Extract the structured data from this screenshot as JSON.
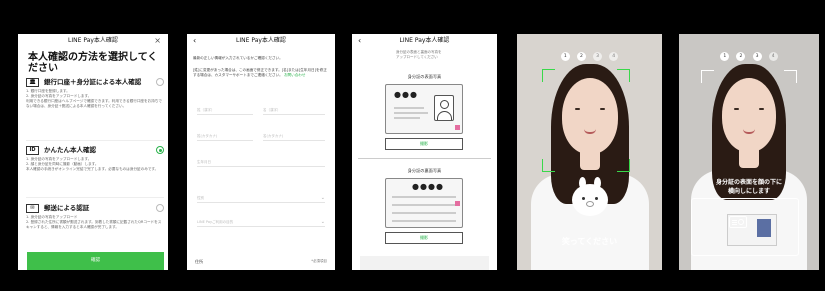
{
  "screen1": {
    "header_title": "LINE Pay本人確認",
    "close": "×",
    "title": "本人確認の方法を選択してください",
    "options": [
      {
        "label": "銀行口座＋身分証による本人確認",
        "icon": "bank-icon",
        "selected": false,
        "desc": "1. 銀行口座を登録します。\n2. 身分証の写真をアップロードします。\n利用できる銀行口座はヘルプページで確認できます。利用できる銀行口座をお持ちでない場合は、身分証＋郵送による本人確認を行ってください。"
      },
      {
        "label": "かんたん本人確認",
        "icon": "id-card-icon",
        "selected": true,
        "desc": "1. 身分証の写真をアップロードします。\n2. 顔と身分証を同時に撮影（動画）します。\n本人確認の手続きがオンライン完結で完了します。必要なものは身分証のみです。"
      },
      {
        "label": "郵送による認証",
        "icon": "mail-icon",
        "selected": false,
        "desc": "1. 身分証の写真をアップロード\n2. 登録された住所に書類が郵送されます。到着した書類に記載されたQRコードをスキャンすると、情報を入力すると本人確認が完了します。"
      }
    ],
    "confirm_label": "確認"
  },
  "screen2": {
    "header_title": "LINE Pay本人確認",
    "back": "‹",
    "intro": "最新の正しい情報が入力されているかご確認ください。",
    "notice": "[姓]に変更があった場合は、この画面で修正できます。[名]または[生年月日]を修正する場合は、カスタマーサポートまでご連絡ください。",
    "notice_link": "お問い合わせ",
    "fields": {
      "last_name": "姓（漢字）",
      "first_name": "名（漢字）",
      "last_kana": "姓(カタカナ)",
      "first_kana": "名(カタカナ)",
      "birthdate": "生年月日",
      "gender": "性別",
      "purpose": "LINE Payご利用の目的"
    },
    "address_label": "住所",
    "required_label": "*必須項目"
  },
  "screen3": {
    "header_title": "LINE Pay本人確認",
    "back": "‹",
    "note": "身分証の表面と裏面の写真を\nアップロードしてください",
    "front_caption": "身分証の表面写真",
    "back_caption": "身分証の裏面写真",
    "front_dots": "●●●",
    "back_dots": "●●●●",
    "snap_label": "撮影"
  },
  "screen4": {
    "steps": [
      "1",
      "2",
      "3",
      "4"
    ],
    "active_step": 2,
    "prompt": "笑ってください"
  },
  "screen5": {
    "steps": [
      "1",
      "2",
      "3",
      "4"
    ],
    "active_step": 3,
    "prompt": "身分証の表面を顔の下に\n横向しにします"
  },
  "colors": {
    "accent": "#3fbf4a",
    "frame": "#39d84a",
    "background": "#000000"
  }
}
